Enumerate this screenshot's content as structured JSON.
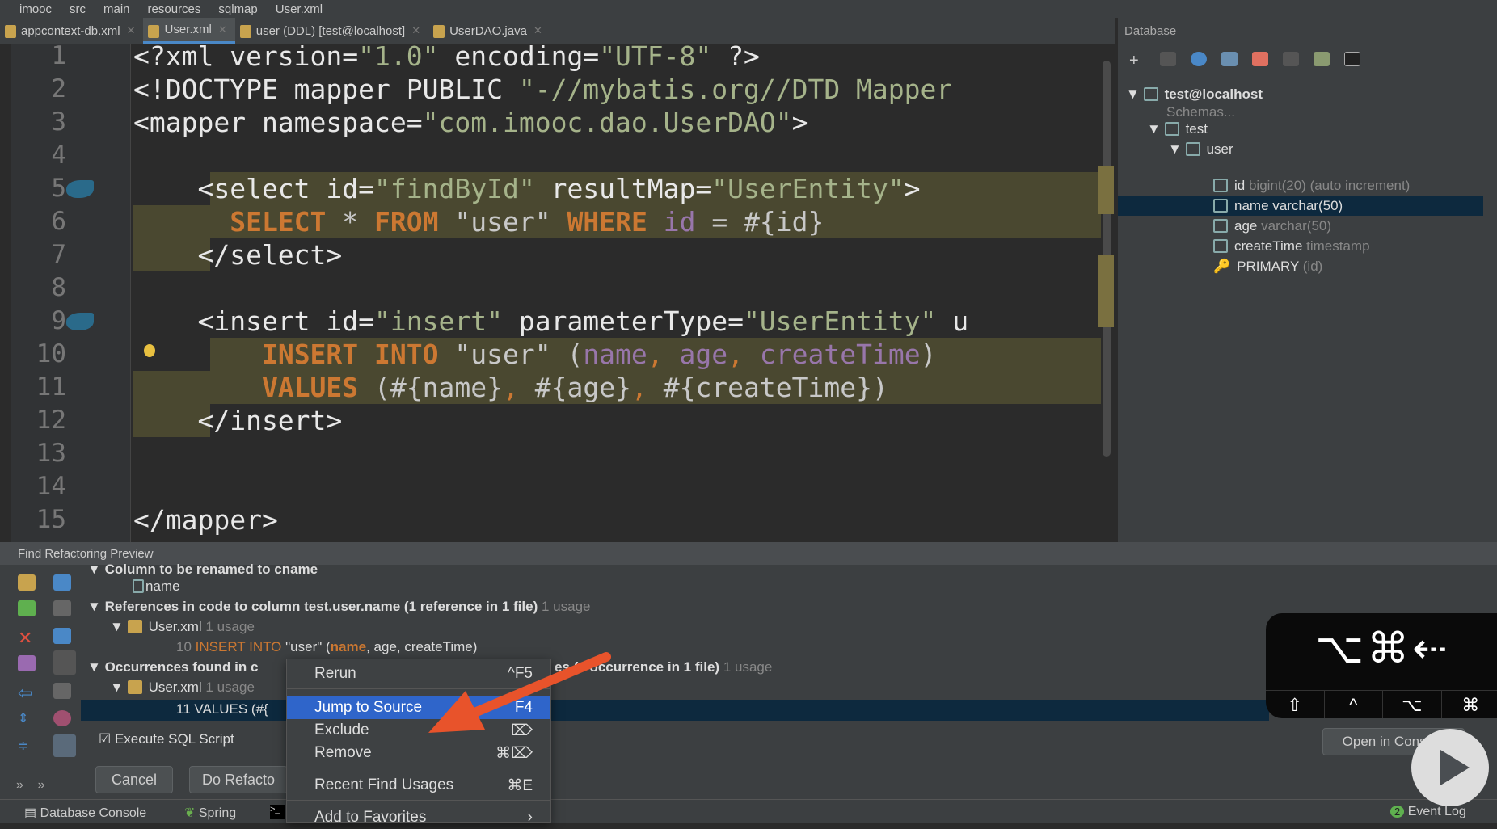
{
  "breadcrumb": [
    "imooc",
    "src",
    "main",
    "resources",
    "sqlmap",
    "User.xml"
  ],
  "tabs": [
    {
      "label": "appcontext-db.xml",
      "active": false
    },
    {
      "label": "User.xml",
      "active": true
    },
    {
      "label": "user (DDL) [test@localhost]",
      "active": false
    },
    {
      "label": "UserDAO.java",
      "active": false
    }
  ],
  "editor": {
    "lines": [
      [
        [
          "<?xml version=",
          "t-tag"
        ],
        [
          "\"1.0\"",
          "t-val"
        ],
        [
          " encoding=",
          "t-tag"
        ],
        [
          "\"UTF-8\"",
          "t-val"
        ],
        [
          " ?>",
          "t-tag"
        ]
      ],
      [
        [
          "<!DOCTYPE mapper PUBLIC ",
          "t-tag"
        ],
        [
          "\"-//mybatis.org//DTD Mapper",
          "t-val"
        ]
      ],
      [
        [
          "<mapper namespace=",
          "t-tag"
        ],
        [
          "\"com.imooc.dao.UserDAO\"",
          "t-val"
        ],
        [
          ">",
          "t-tag"
        ]
      ],
      [],
      [
        [
          "    <select id=",
          "t-tag"
        ],
        [
          "\"findById\"",
          "t-val"
        ],
        [
          " resultMap=",
          "t-tag"
        ],
        [
          "\"UserEntity\"",
          "t-val"
        ],
        [
          ">",
          "t-tag"
        ]
      ],
      [
        [
          "      ",
          ""
        ],
        [
          "SELECT",
          "t-kw"
        ],
        [
          " * ",
          "t-str"
        ],
        [
          "FROM",
          "t-kw"
        ],
        [
          " \"user\" ",
          "t-str"
        ],
        [
          "WHERE",
          "t-kw"
        ],
        [
          " ",
          "t-str"
        ],
        [
          "id",
          "t-col"
        ],
        [
          " = #{id}",
          "t-str"
        ]
      ],
      [
        [
          "    </select>",
          "t-tag"
        ]
      ],
      [],
      [
        [
          "    <insert id=",
          "t-tag"
        ],
        [
          "\"insert\"",
          "t-val"
        ],
        [
          " parameterType=",
          "t-tag"
        ],
        [
          "\"UserEntity\"",
          "t-val"
        ],
        [
          " u",
          "t-tag"
        ]
      ],
      [
        [
          "        ",
          ""
        ],
        [
          "INSERT INTO",
          "t-kw"
        ],
        [
          " \"user\" (",
          "t-str"
        ],
        [
          "name",
          "t-col"
        ],
        [
          ", ",
          "t-op"
        ],
        [
          "age",
          "t-col"
        ],
        [
          ", ",
          "t-op"
        ],
        [
          "createTime",
          "t-col"
        ],
        [
          ")",
          "t-str"
        ]
      ],
      [
        [
          "        ",
          ""
        ],
        [
          "VALUES",
          "t-kw"
        ],
        [
          " (#{name}",
          "t-str"
        ],
        [
          ", ",
          "t-op"
        ],
        [
          "#{age}",
          "t-str"
        ],
        [
          ", ",
          "t-op"
        ],
        [
          "#{createTime})",
          "t-str"
        ]
      ],
      [
        [
          "    </insert>",
          "t-tag"
        ]
      ],
      [],
      [],
      [
        [
          "</mapper>",
          "t-tag"
        ]
      ]
    ],
    "line_numbers": [
      "1",
      "2",
      "3",
      "4",
      "5",
      "6",
      "7",
      "8",
      "9",
      "10",
      "11",
      "12",
      "13",
      "14",
      "15"
    ]
  },
  "database": {
    "title": "Database",
    "tree": {
      "connection": "test@localhost",
      "schemas": "Schemas...",
      "schema": "test",
      "table": "user",
      "columns": [
        {
          "name": "id",
          "type": "bigint(20) (auto increment)"
        },
        {
          "name": "name",
          "type": "varchar(50)",
          "selected": true
        },
        {
          "name": "age",
          "type": "varchar(50)"
        },
        {
          "name": "createTime",
          "type": "timestamp"
        }
      ],
      "key": {
        "name": "PRIMARY",
        "type": "(id)"
      }
    }
  },
  "preview": {
    "title": "Find Refactoring Preview",
    "row0": "Column to be renamed to cname",
    "row1": "name",
    "refs_bold": "References in code to column test.user.name (1 reference in 1 file)",
    "refs_usage": "1 usage",
    "file1": "User.xml",
    "file_usage": "1 usage",
    "line10_num": "10",
    "line10_kw": "INSERT INTO",
    "line10_str": "\"user\" (",
    "line10_name": "name",
    "line10_rest": ", age, createTime)",
    "occ_bold": "Occurrences found in c",
    "occ_tail": "es (1 occurrence in 1 file)",
    "occ_usage": "1 usage",
    "file2": "User.xml",
    "line11": "11 VALUES (#{",
    "execute_sql": "Execute SQL Script",
    "cancel": "Cancel",
    "do_refactor": "Do Refacto",
    "open_console": "Open in Console"
  },
  "menu": {
    "items": [
      {
        "label": "Rerun",
        "shortcut": "^F5"
      },
      {
        "label": "Jump to Source",
        "shortcut": "F4",
        "selected": true
      },
      {
        "label": "Exclude",
        "shortcut": "⌦"
      },
      {
        "label": "Remove",
        "shortcut": "⌘⌦"
      },
      {
        "label": "Recent Find Usages",
        "shortcut": "⌘E"
      },
      {
        "label": "Add to Favorites",
        "shortcut": "›"
      }
    ]
  },
  "bottombar": {
    "database_console": "Database Console",
    "spring": "Spring",
    "event_log": "Event Log",
    "event_count": "2"
  },
  "overlay": {
    "keys": "⌥⌘⇠",
    "mods": [
      "⇧",
      "^",
      "⌥",
      "⌘"
    ]
  },
  "colors": {
    "accent": "#2f65ca",
    "arrow": "#e8532b",
    "selection": "#0d293e",
    "highlight": "#4a4830"
  }
}
